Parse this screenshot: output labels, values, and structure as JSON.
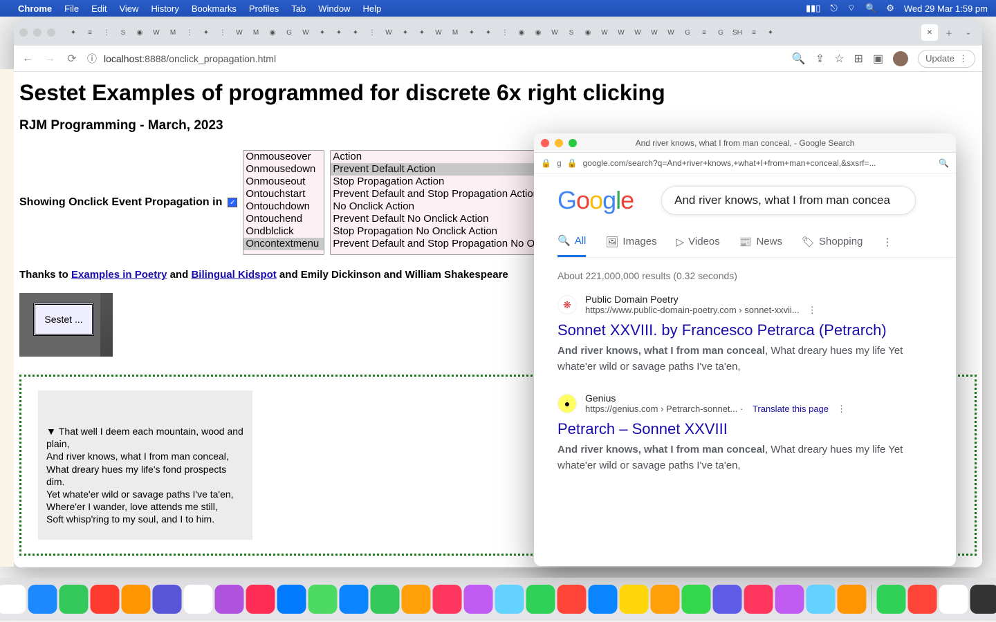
{
  "menubar": {
    "app": "Chrome",
    "items": [
      "File",
      "Edit",
      "View",
      "History",
      "Bookmarks",
      "Profiles",
      "Tab",
      "Window",
      "Help"
    ],
    "clock": "Wed 29 Mar  1:59 pm"
  },
  "chrome": {
    "url_host": "localhost",
    "url_path": ":8888/onclick_propagation.html",
    "update": "Update"
  },
  "page": {
    "title": "Sestet Examples of programmed for discrete 6x right clicking",
    "subtitle": "RJM Programming - March, 2023",
    "event_label": "Showing Onclick Event Propagation in",
    "list1": [
      "Onmouseover",
      "Onmousedown",
      "Onmouseout",
      "Ontouchstart",
      "Ontouchdown",
      "Ontouchend",
      "Ondblclick",
      "Oncontextmenu"
    ],
    "list1_selected": "Oncontextmenu",
    "list2": [
      "Action",
      "Prevent Default Action",
      "Stop Propagation Action",
      "Prevent Default and Stop Propagation Action",
      "No Onclick Action",
      "Prevent Default No Onclick Action",
      "Stop Propagation No Onclick Action",
      "Prevent Default and Stop Propagation No Oncli"
    ],
    "list2_selected": "Prevent Default Action",
    "thanks_prefix": "Thanks to ",
    "thanks_link1": "Examples in Poetry",
    "thanks_and": " and ",
    "thanks_link2": "Bilingual Kidspot",
    "thanks_suffix": " and Emily Dickinson and William Shakespeare",
    "sestet_btn": "Sestet ...",
    "poem": [
      "That well I deem each mountain, wood and plain,",
      "And river knows, what I from man conceal,",
      "What dreary hues my life's fond prospects dim.",
      "Yet whate'er wild or savage paths I've ta'en,",
      "Where'er I wander, love attends me still,",
      "Soft whisp'ring to my soul, and I to him."
    ]
  },
  "google": {
    "window_title": "And river knows, what I from man conceal, - Google Search",
    "addr": "google.com/search?q=And+river+knows,+what+I+from+man+conceal,&sxsrf=...",
    "query": "And river knows, what I from man concea",
    "tabs": [
      "All",
      "Images",
      "Videos",
      "News",
      "Shopping"
    ],
    "stats": "About 221,000,000 results (0.32 seconds)",
    "results": [
      {
        "source": "Public Domain Poetry",
        "url": "https://www.public-domain-poetry.com › sonnet-xxvii...",
        "title": "Sonnet XXVIII. by Francesco Petrarca (Petrarch)",
        "bold": "And river knows, what I from man conceal",
        "rest": ", What dreary hues my life Yet whate'er wild or savage paths I've ta'en,",
        "favicon": "❋",
        "favicon_bg": "#fff",
        "favicon_color": "#d33"
      },
      {
        "source": "Genius",
        "url": "https://genius.com › Petrarch-sonnet...",
        "title": "Petrarch – Sonnet XXVIII",
        "bold": "And river knows, what I from man conceal",
        "rest": ", What dreary hues my life Yet whate'er wild or savage paths I've ta'en,",
        "translate": "Translate this page",
        "favicon": "●",
        "favicon_bg": "#ffff64",
        "favicon_color": "#000"
      }
    ]
  },
  "dock_colors": [
    "#ffffff",
    "#1e88ff",
    "#34c759",
    "#ff3b30",
    "#ff9500",
    "#5856d6",
    "#ffffff",
    "#af52de",
    "#ff2d55",
    "#007aff",
    "#4cd964",
    "#0a84ff",
    "#34c759",
    "#ff9f0a",
    "#ff375f",
    "#bf5af2",
    "#64d2ff",
    "#30d158",
    "#ff453a",
    "#0a84ff",
    "#ffd60a",
    "#ff9f0a",
    "#32d74b",
    "#5e5ce6",
    "#ff375f",
    "#bf5af2",
    "#64d2ff",
    "#ff9500",
    "#30d158",
    "#ff453a",
    "#ffffff",
    "#333333"
  ]
}
